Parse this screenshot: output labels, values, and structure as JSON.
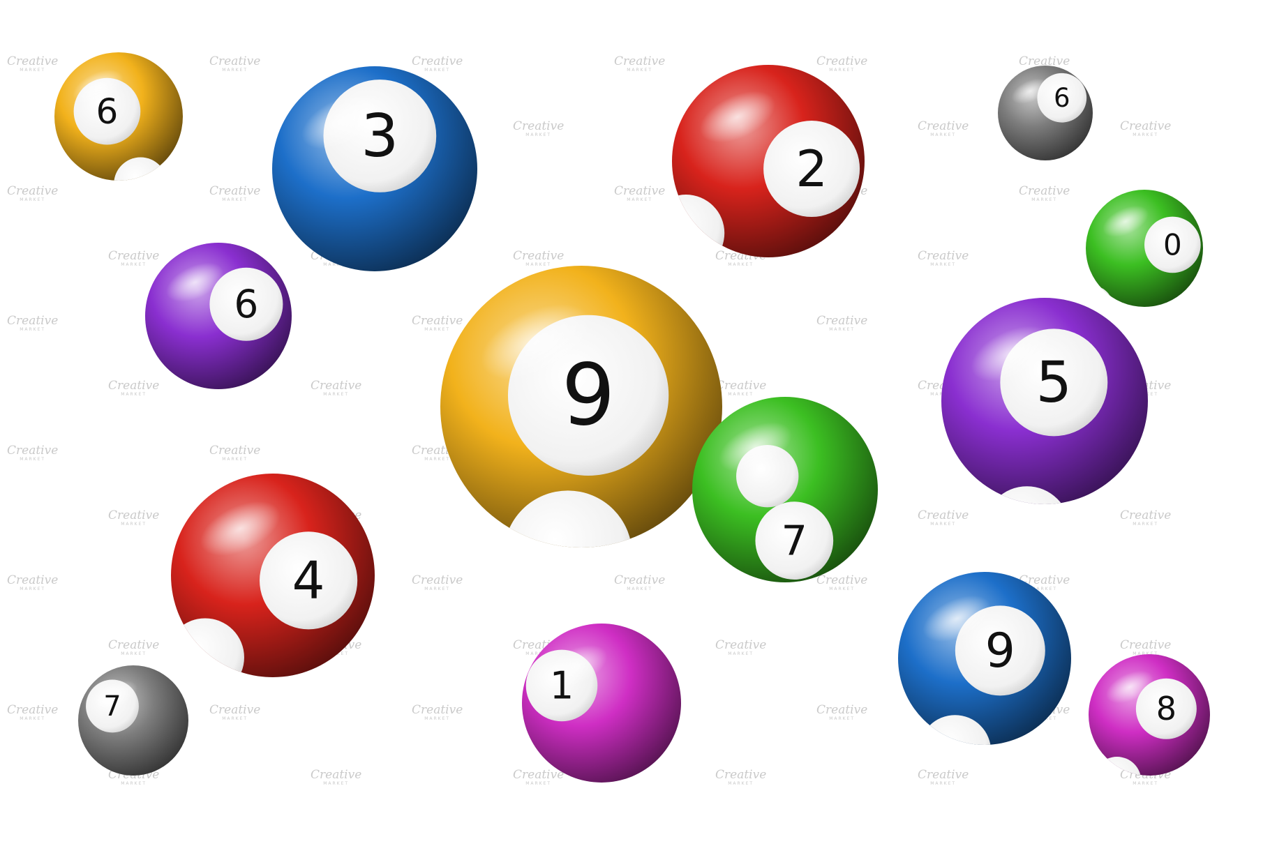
{
  "watermark": {
    "brand": "Creative",
    "sub": "MARKET"
  },
  "colors": {
    "background": "#ffffff",
    "yellow": "#f2b21c",
    "blue": "#1d6fc9",
    "red": "#d8231c",
    "purple": "#8a2fd0",
    "green": "#3cbf22",
    "magenta": "#cf2ec4",
    "gray": "#7d7d7d"
  },
  "balls": [
    {
      "id": "ball-yellow-6",
      "color": "yellow",
      "number": "6"
    },
    {
      "id": "ball-blue-3",
      "color": "blue",
      "number": "3"
    },
    {
      "id": "ball-red-2",
      "color": "red",
      "number": "2"
    },
    {
      "id": "ball-gray-6",
      "color": "gray",
      "number": "6"
    },
    {
      "id": "ball-purple-6",
      "color": "purple",
      "number": "6"
    },
    {
      "id": "ball-green-0",
      "color": "green",
      "number": "0"
    },
    {
      "id": "ball-yellow-9",
      "color": "yellow",
      "number": "9"
    },
    {
      "id": "ball-green-7",
      "color": "green",
      "number": "7"
    },
    {
      "id": "ball-purple-5",
      "color": "purple",
      "number": "5"
    },
    {
      "id": "ball-red-4",
      "color": "red",
      "number": "4"
    },
    {
      "id": "ball-blue-9",
      "color": "blue",
      "number": "9"
    },
    {
      "id": "ball-magenta-1",
      "color": "magenta",
      "number": "1"
    },
    {
      "id": "ball-magenta-8",
      "color": "magenta",
      "number": "8"
    },
    {
      "id": "ball-gray-7",
      "color": "gray",
      "number": "7"
    }
  ]
}
